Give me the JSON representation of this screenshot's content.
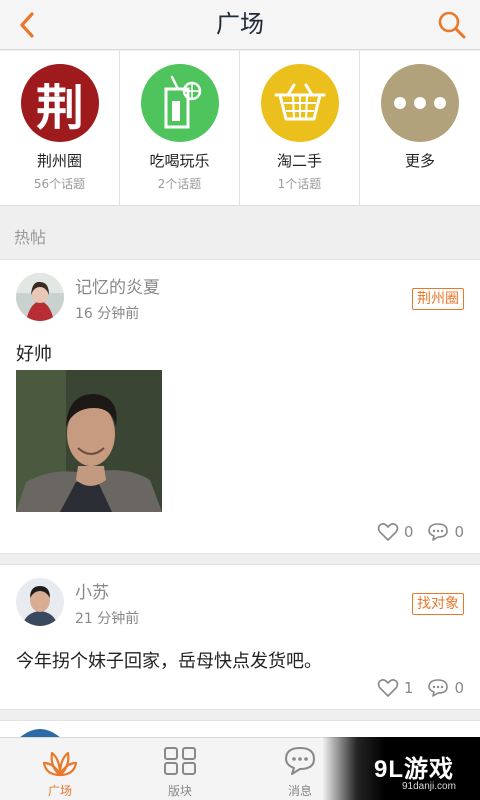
{
  "header": {
    "title": "广场"
  },
  "categories": [
    {
      "icon_char": "荆",
      "name": "荆州圈",
      "topics": "56个话题",
      "color": "#9e1a1c"
    },
    {
      "name": "吃喝玩乐",
      "topics": "2个话题",
      "color": "#4fc45d"
    },
    {
      "name": "淘二手",
      "topics": "1个话题",
      "color": "#ecc01c"
    },
    {
      "name": "更多",
      "topics": "",
      "color": "#b1a27b"
    }
  ],
  "section": {
    "label": "热帖"
  },
  "posts": [
    {
      "username": "记忆的炎夏",
      "time": "16 分钟前",
      "tag": "荆州圈",
      "content": "好帅",
      "likes": "0",
      "comments": "0"
    },
    {
      "username": "小苏",
      "time": "21 分钟前",
      "tag": "找对象",
      "content": "今年拐个妹子回家，岳母快点发货吧。",
      "likes": "1",
      "comments": "0"
    }
  ],
  "tabbar": {
    "items": [
      {
        "label": "广场"
      },
      {
        "label": "版块"
      },
      {
        "label": "消息"
      }
    ]
  },
  "watermark": {
    "main": "9L游戏",
    "sub": "91danji.com"
  },
  "colors": {
    "accent": "#e8782a",
    "muted": "#888888"
  }
}
